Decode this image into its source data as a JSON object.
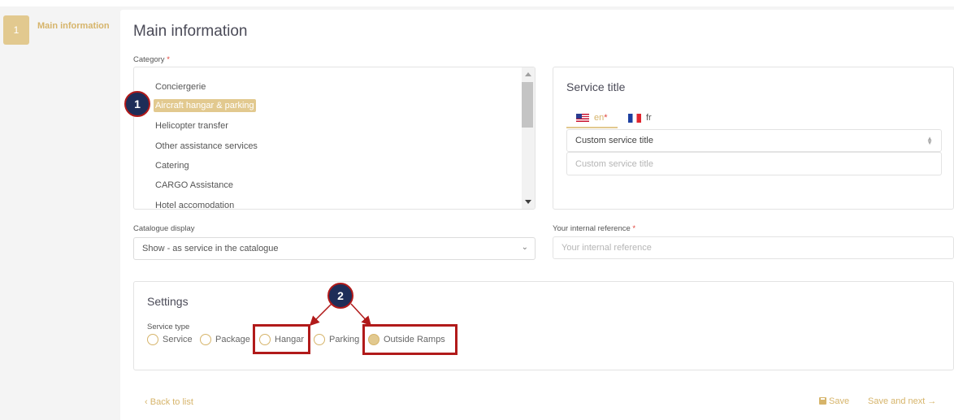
{
  "stepper": {
    "steps": [
      {
        "number": "1",
        "label": "Main information"
      }
    ]
  },
  "main": {
    "title": "Main information",
    "category": {
      "label": "Category",
      "required_mark": "*",
      "items": [
        "Conciergerie",
        "Aircraft hangar & parking",
        "Helicopter transfer",
        "Other assistance services",
        "Catering",
        "CARGO Assistance",
        "Hotel accomodation"
      ],
      "selected": "Aircraft hangar & parking"
    },
    "service_title": {
      "title": "Service title",
      "tabs": [
        {
          "code": "en",
          "mark": "*",
          "flag": "us-flag-icon",
          "active": true
        },
        {
          "code": "fr",
          "flag": "fr-flag-icon",
          "active": false
        }
      ],
      "select_value": "Custom service title",
      "input_placeholder": "Custom service title"
    },
    "catalogue_display": {
      "label": "Catalogue display",
      "value": "Show - as service in the catalogue"
    },
    "internal_reference": {
      "label": "Your internal reference",
      "required_mark": "*",
      "placeholder": "Your internal reference"
    },
    "settings": {
      "title": "Settings",
      "service_type_label": "Service type",
      "options": [
        {
          "label": "Service",
          "checked": false
        },
        {
          "label": "Package",
          "checked": false
        },
        {
          "label": "Hangar",
          "checked": false
        },
        {
          "label": "Parking",
          "checked": false
        },
        {
          "label": "Outside Ramps",
          "checked": true
        }
      ]
    }
  },
  "footer": {
    "back_label": "Back to list",
    "back_icon": "chevron-left-icon",
    "save_label": "Save",
    "save_icon": "save-disk-icon",
    "save_next_label": "Save and next",
    "save_next_icon": "arrow-right-icon"
  },
  "annotations": {
    "badges": [
      "1",
      "2"
    ],
    "color": "#b11a1a",
    "badge_fill": "#1e2d58"
  },
  "colors": {
    "accent": "#e2c98f",
    "accent_text": "#d6b46a",
    "required": "#e0443a"
  }
}
